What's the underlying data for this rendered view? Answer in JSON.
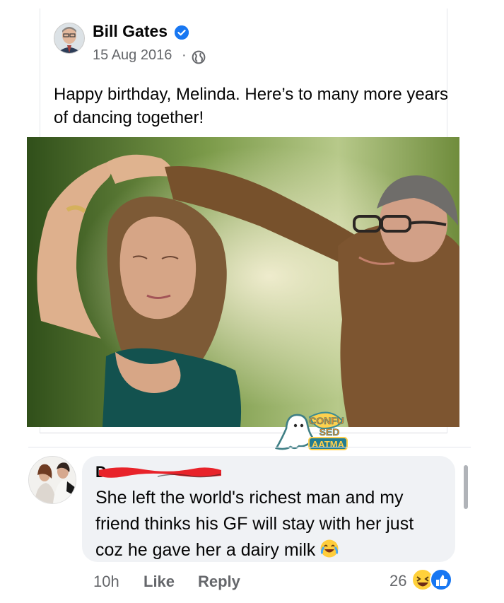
{
  "post": {
    "author": "Bill Gates",
    "date": "15 Aug 2016",
    "separator": "·",
    "text": "Happy birthday, Melinda. Here’s to many more years of dancing together!",
    "verified_icon": "verified-badge-icon",
    "privacy_icon": "globe-icon"
  },
  "watermark": {
    "lines": [
      "CONFU",
      "SED",
      "AATMA"
    ]
  },
  "comment": {
    "author_initial": "D",
    "text": "She left the world's richest man and my friend thinks his GF will stay with her just coz he gave her a dairy milk",
    "emoji": "laughing-crying-emoji-icon",
    "time": "10h",
    "like_label": "Like",
    "reply_label": "Reply",
    "reaction_count": "26",
    "reactions": [
      "haha-reaction-icon",
      "like-reaction-icon"
    ]
  },
  "colors": {
    "accent": "#1877f2",
    "secondary_text": "#65676b",
    "bubble": "#f0f2f5",
    "redaction": "#e8232a"
  }
}
